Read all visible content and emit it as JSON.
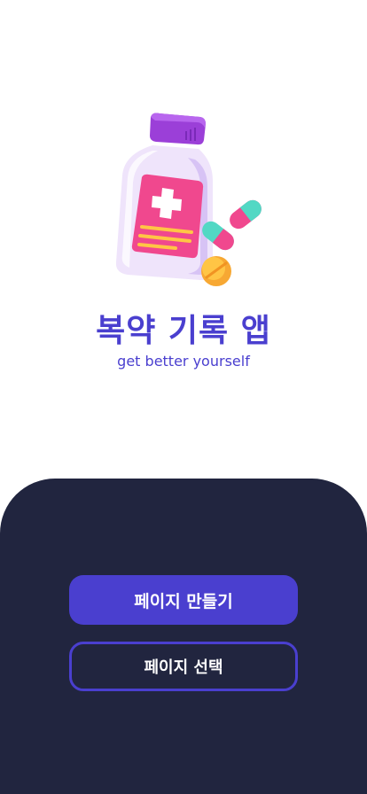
{
  "app": {
    "title": "복약 기록 앱",
    "subtitle": "get better yourself"
  },
  "actions": {
    "create_page_label": "페이지 만들기",
    "select_page_label": "페이지 선택"
  },
  "illustration": {
    "icon": "medicine-bottle-with-pills-icon"
  },
  "colors": {
    "accent": "#4a3fcf",
    "panel": "#21253f",
    "background": "#ffffff"
  }
}
